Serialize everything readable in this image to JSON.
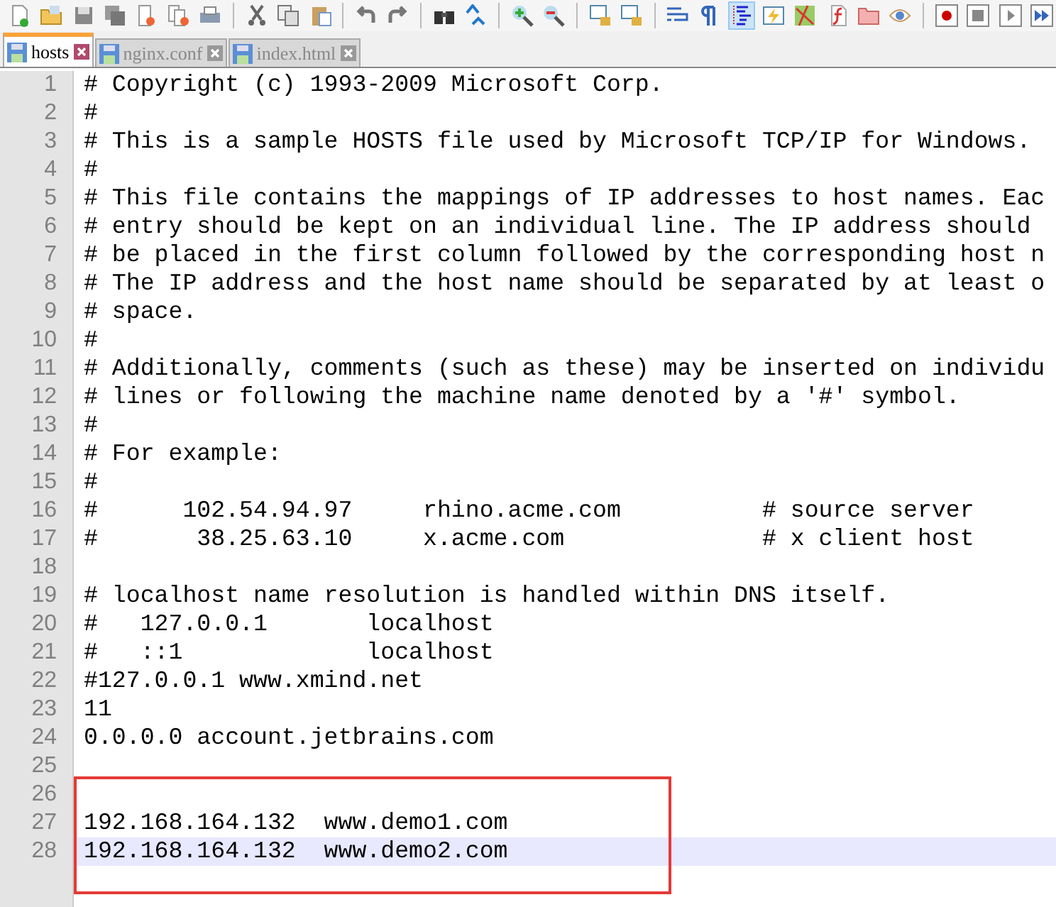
{
  "toolbar": [
    {
      "kind": "new",
      "selected": false
    },
    {
      "kind": "open",
      "selected": false
    },
    {
      "kind": "save",
      "selected": false
    },
    {
      "kind": "save-all",
      "selected": false
    },
    {
      "kind": "close",
      "selected": false
    },
    {
      "kind": "close-all",
      "selected": false
    },
    {
      "kind": "print",
      "selected": false
    },
    {
      "kind": "sep"
    },
    {
      "kind": "cut",
      "selected": false
    },
    {
      "kind": "copy",
      "selected": false
    },
    {
      "kind": "paste",
      "selected": false
    },
    {
      "kind": "sep"
    },
    {
      "kind": "undo",
      "selected": false
    },
    {
      "kind": "redo",
      "selected": false
    },
    {
      "kind": "sep"
    },
    {
      "kind": "find",
      "selected": false
    },
    {
      "kind": "replace",
      "selected": false
    },
    {
      "kind": "sep"
    },
    {
      "kind": "zoom-in",
      "selected": false
    },
    {
      "kind": "zoom-out",
      "selected": false
    },
    {
      "kind": "sep"
    },
    {
      "kind": "lock",
      "selected": false
    },
    {
      "kind": "lock",
      "selected": false
    },
    {
      "kind": "sep"
    },
    {
      "kind": "wrap",
      "selected": false
    },
    {
      "kind": "pilcrow",
      "selected": false
    },
    {
      "kind": "indent",
      "selected": true
    },
    {
      "kind": "lightning",
      "selected": false
    },
    {
      "kind": "map",
      "selected": false
    },
    {
      "kind": "function",
      "selected": false
    },
    {
      "kind": "folder",
      "selected": false
    },
    {
      "kind": "eye",
      "selected": false
    },
    {
      "kind": "sep"
    },
    {
      "kind": "record",
      "selected": false
    },
    {
      "kind": "stop",
      "selected": false
    },
    {
      "kind": "play",
      "selected": false
    },
    {
      "kind": "play-all",
      "selected": false
    }
  ],
  "tabs": [
    {
      "label": "hosts",
      "selected": true
    },
    {
      "label": "nginx.conf",
      "selected": false
    },
    {
      "label": "index.html",
      "selected": false
    }
  ],
  "lines": [
    {
      "number": "1",
      "text": "# Copyright (c) 1993-2009 Microsoft Corp."
    },
    {
      "number": "2",
      "text": "#"
    },
    {
      "number": "3",
      "text": "# This is a sample HOSTS file used by Microsoft TCP/IP for Windows."
    },
    {
      "number": "4",
      "text": "#"
    },
    {
      "number": "5",
      "text": "# This file contains the mappings of IP addresses to host names. Eac"
    },
    {
      "number": "6",
      "text": "# entry should be kept on an individual line. The IP address should"
    },
    {
      "number": "7",
      "text": "# be placed in the first column followed by the corresponding host n"
    },
    {
      "number": "8",
      "text": "# The IP address and the host name should be separated by at least o"
    },
    {
      "number": "9",
      "text": "# space."
    },
    {
      "number": "10",
      "text": "#"
    },
    {
      "number": "11",
      "text": "# Additionally, comments (such as these) may be inserted on individu"
    },
    {
      "number": "12",
      "text": "# lines or following the machine name denoted by a '#' symbol."
    },
    {
      "number": "13",
      "text": "#"
    },
    {
      "number": "14",
      "text": "# For example:"
    },
    {
      "number": "15",
      "text": "#"
    },
    {
      "number": "16",
      "text": "#      102.54.94.97     rhino.acme.com          # source server"
    },
    {
      "number": "17",
      "text": "#       38.25.63.10     x.acme.com              # x client host"
    },
    {
      "number": "18"
    },
    {
      "number": "19",
      "text": "# localhost name resolution is handled within DNS itself."
    },
    {
      "number": "20",
      "text": "#   127.0.0.1       localhost"
    },
    {
      "number": "21",
      "text": "#   ::1             localhost"
    },
    {
      "number": "22",
      "text": "#127.0.0.1 www.xmind.net"
    },
    {
      "number": "23",
      "text": "11"
    },
    {
      "number": "24",
      "text": "0.0.0.0 account.jetbrains.com"
    },
    {
      "number": "25"
    }
  ],
  "boxed_lines": [
    {
      "number": "26",
      "current": false
    },
    {
      "number": "27",
      "text": "192.168.164.132  www.demo1.com",
      "current": false
    },
    {
      "number": "28",
      "text": "192.168.164.132  www.demo2.com",
      "current": true
    }
  ]
}
